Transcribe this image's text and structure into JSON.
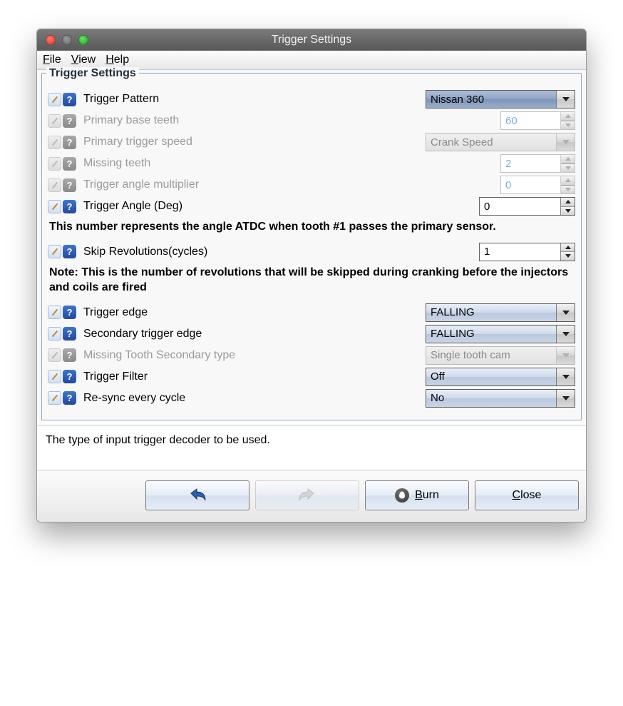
{
  "window": {
    "title": "Trigger Settings"
  },
  "menu": {
    "file": "File",
    "view": "View",
    "help": "Help"
  },
  "group": {
    "title": "Trigger Settings"
  },
  "fields": {
    "triggerPattern": {
      "label": "Trigger Pattern",
      "value": "Nissan 360",
      "type": "dropdown",
      "enabled": true,
      "selected": true
    },
    "primaryBaseTeeth": {
      "label": "Primary base teeth",
      "value": "60",
      "type": "spinner",
      "enabled": false
    },
    "primaryTrigSpeed": {
      "label": "Primary trigger speed",
      "value": "Crank Speed",
      "type": "dropdown",
      "enabled": false
    },
    "missingTeeth": {
      "label": "Missing teeth",
      "value": "2",
      "type": "spinner",
      "enabled": false
    },
    "trigAngleMult": {
      "label": "Trigger angle multiplier",
      "value": "0",
      "type": "spinner",
      "enabled": false
    },
    "trigAngle": {
      "label": "Trigger Angle (Deg)",
      "value": "0",
      "type": "spinner",
      "enabled": true,
      "wide": true
    },
    "skipRevs": {
      "label": "Skip Revolutions(cycles)",
      "value": "1",
      "type": "spinner",
      "enabled": true,
      "wide": true
    },
    "trigEdge": {
      "label": "Trigger edge",
      "value": "FALLING",
      "type": "dropdown",
      "enabled": true
    },
    "secTrigEdge": {
      "label": "Secondary trigger edge",
      "value": "FALLING",
      "type": "dropdown",
      "enabled": true
    },
    "missToothSec": {
      "label": "Missing Tooth Secondary type",
      "value": "Single tooth cam",
      "type": "dropdown",
      "enabled": false
    },
    "trigFilter": {
      "label": "Trigger Filter",
      "value": "Off",
      "type": "dropdown",
      "enabled": true
    },
    "resync": {
      "label": "Re-sync every cycle",
      "value": "No",
      "type": "dropdown",
      "enabled": true
    }
  },
  "notes": {
    "angle": "This number represents the angle ATDC when tooth #1 passes the primary sensor.",
    "skip": "Note: This is the number of revolutions that will be skipped during cranking before the injectors and coils are fired"
  },
  "status": "The type of input trigger decoder to be used.",
  "buttons": {
    "burn": "Burn",
    "close": "Close"
  }
}
